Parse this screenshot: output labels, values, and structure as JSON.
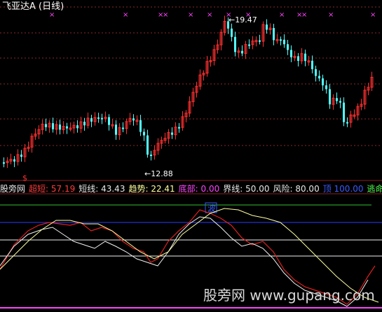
{
  "title": "飞亚达A (日线)",
  "price_labels": {
    "high": "19.47",
    "low": "12.88"
  },
  "signal_letter": "$",
  "indicator_tag": "波",
  "legend": [
    {
      "label": "股旁网",
      "value": "",
      "color": "#e8e8e8"
    },
    {
      "label": "超短:",
      "value": "57.19",
      "color": "#ff3c3c"
    },
    {
      "label": "短线:",
      "value": "43.43",
      "color": "#e8e8e8"
    },
    {
      "label": "趋势:",
      "value": "22.41",
      "color": "#ffffa0"
    },
    {
      "label": "底部:",
      "value": "0.00",
      "color": "#ff44ff"
    },
    {
      "label": "界线:",
      "value": "50.00",
      "color": "#e8e8e8"
    },
    {
      "label": "风险:",
      "value": "80.00",
      "color": "#e8e8e8"
    },
    {
      "label": "顶",
      "value": "100.00",
      "color": "#3a5cff"
    },
    {
      "label": "逃命:",
      "value": "",
      "color": "#50ff50"
    }
  ],
  "watermark": "股旁网 www.gupang.com",
  "colors": {
    "up": "#ff3030",
    "down": "#54ffff",
    "ultra_short": "#e02020",
    "short": "#f0f0f0",
    "trend": "#ffffa0",
    "bottom": "#ff44ff",
    "top": "#2a3cff",
    "escape": "#30c030",
    "grid": "#8a2a2a",
    "marker": "#ff44ff"
  }
}
